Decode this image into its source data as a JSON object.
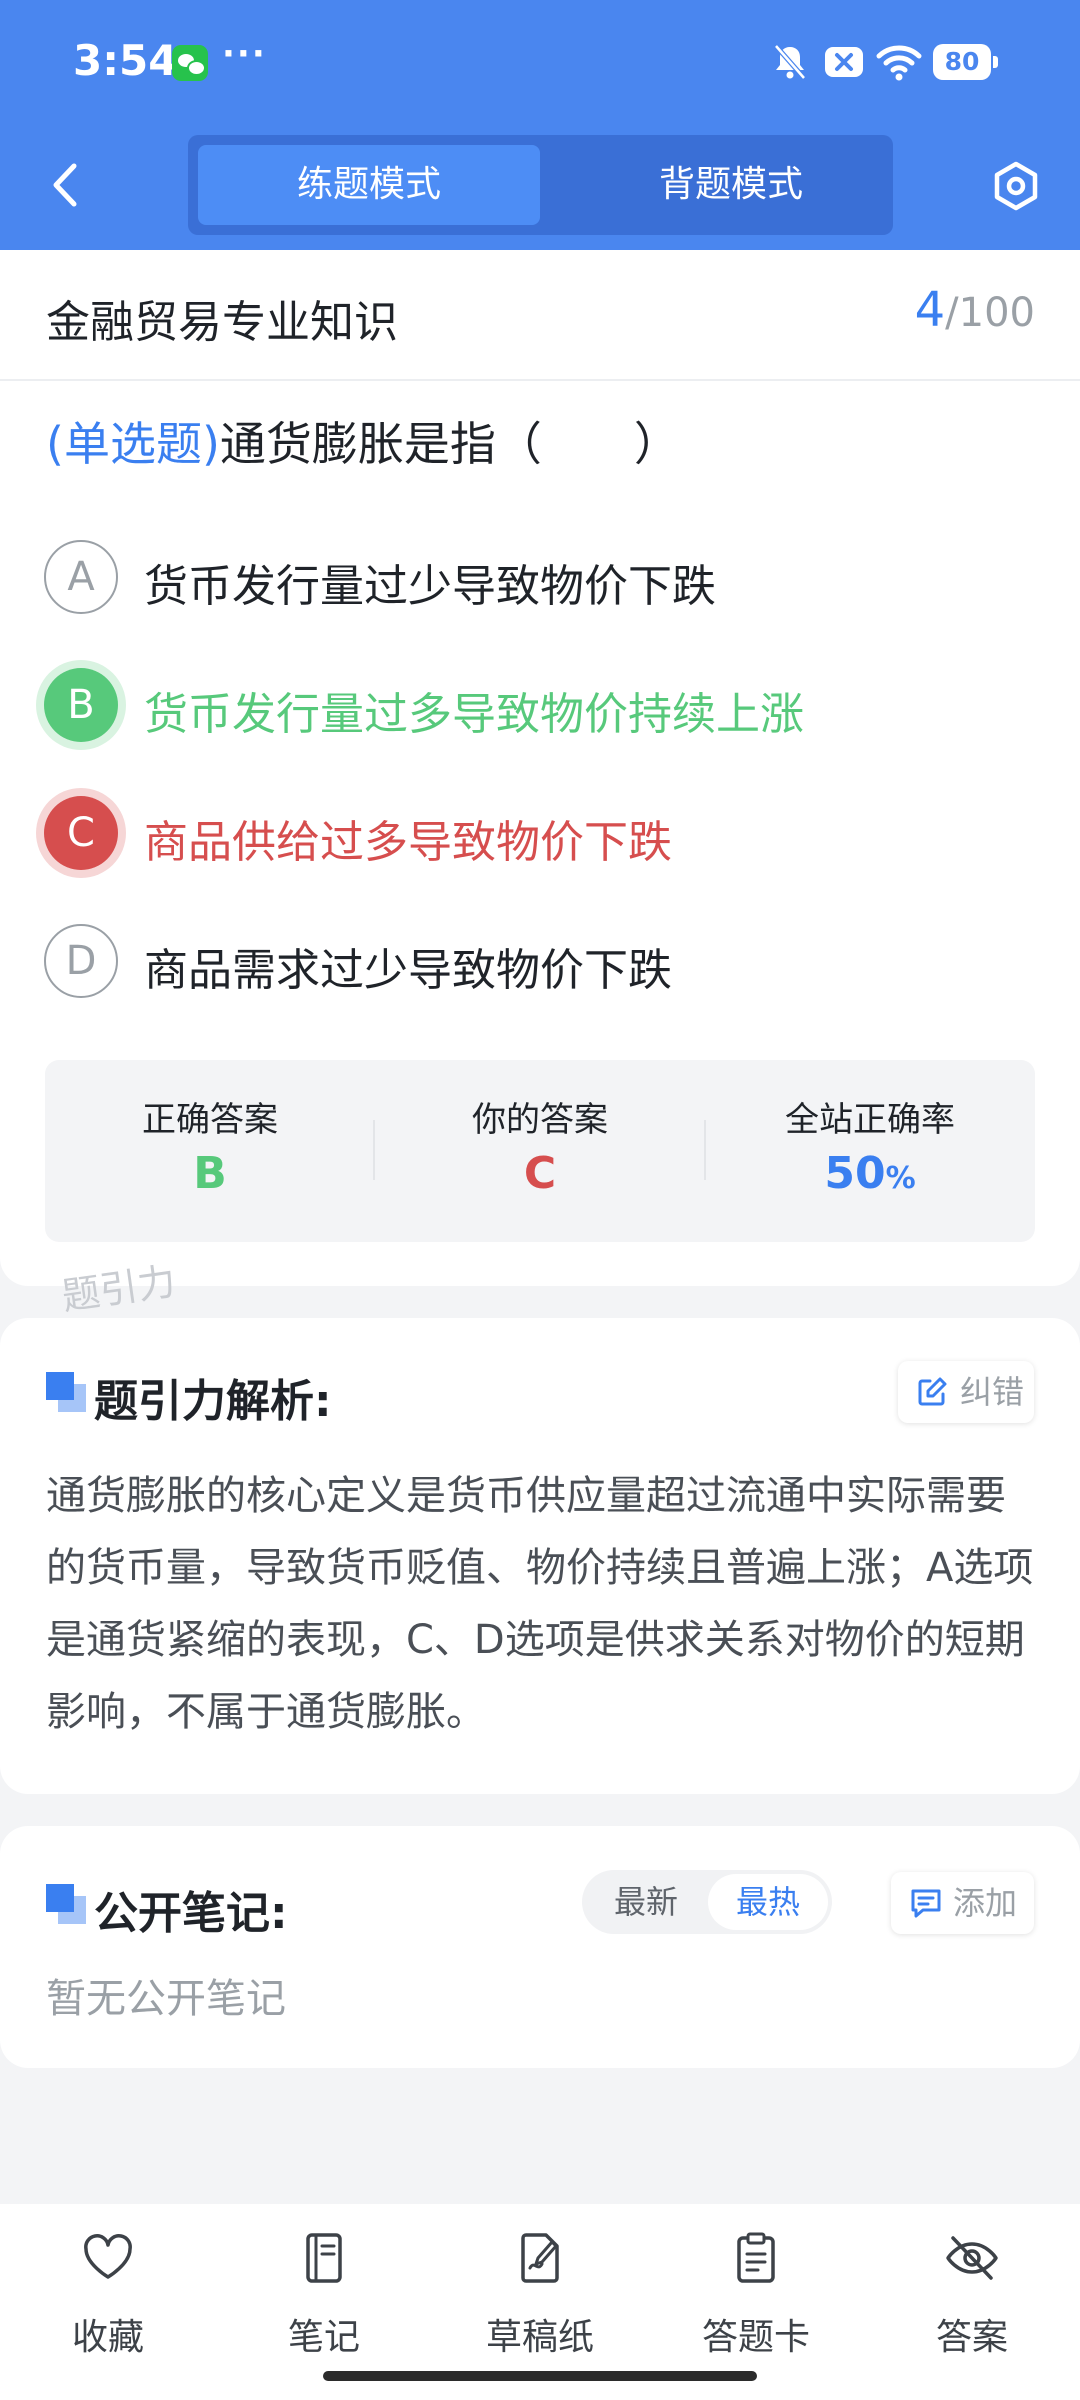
{
  "status_bar": {
    "time": "3:54",
    "battery": "80",
    "more": "···"
  },
  "header": {
    "tabs": [
      {
        "label": "练题模式",
        "active": true
      },
      {
        "label": "背题模式",
        "active": false
      }
    ]
  },
  "subject": {
    "title": "金融贸易专业知识",
    "current": "4",
    "total": "/100"
  },
  "question": {
    "type": "(单选题)",
    "text": "通货膨胀是指（　　）",
    "options": [
      {
        "letter": "A",
        "text": "货币发行量过少导致物价下跌",
        "state": "normal"
      },
      {
        "letter": "B",
        "text": "货币发行量过多导致物价持续上涨",
        "state": "correct"
      },
      {
        "letter": "C",
        "text": "商品供给过多导致物价下跌",
        "state": "wrong"
      },
      {
        "letter": "D",
        "text": "商品需求过少导致物价下跌",
        "state": "normal"
      }
    ]
  },
  "stats": {
    "correct_label": "正确答案",
    "correct_value": "B",
    "yours_label": "你的答案",
    "yours_value": "C",
    "rate_label": "全站正确率",
    "rate_value": "50",
    "rate_unit": "%"
  },
  "watermark": "题引力",
  "analysis": {
    "title": "题引力解析:",
    "report_label": "纠错",
    "text": "通货膨胀的核心定义是货币供应量超过流通中实际需要的货币量，导致货币贬值、物价持续且普遍上涨；A选项是通货紧缩的表现，C、D选项是供求关系对物价的短期影响，不属于通货膨胀。"
  },
  "notes": {
    "title": "公开笔记:",
    "sort_latest": "最新",
    "sort_hot": "最热",
    "add_label": "添加",
    "empty": "暂无公开笔记"
  },
  "tabbar": [
    {
      "label": "收藏",
      "icon": "heart-icon"
    },
    {
      "label": "笔记",
      "icon": "notebook-icon"
    },
    {
      "label": "草稿纸",
      "icon": "draft-icon"
    },
    {
      "label": "答题卡",
      "icon": "clipboard-icon"
    },
    {
      "label": "答案",
      "icon": "eye-off-icon"
    }
  ],
  "colors": {
    "brand": "#4a86ef",
    "correct": "#57c97b",
    "wrong": "#d64e4e",
    "accent": "#3a7ff0"
  }
}
